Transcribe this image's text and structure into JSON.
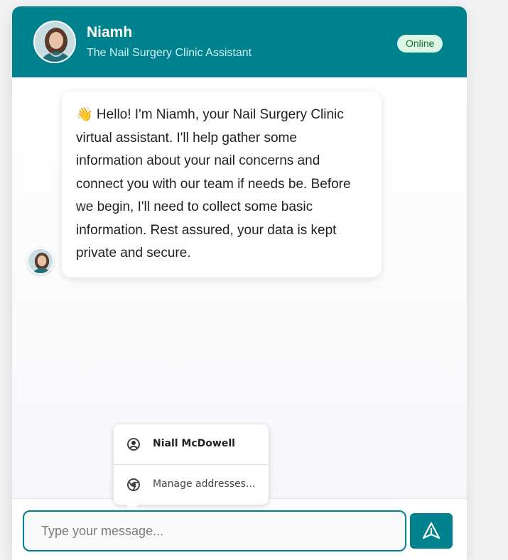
{
  "header": {
    "name": "Niamh",
    "subtitle": "The Nail Surgery Clinic Assistant",
    "status": "Online"
  },
  "messages": [
    {
      "sender": "assistant",
      "text": "👋 Hello! I'm Niamh, your Nail Surgery Clinic virtual assistant. I'll help gather some information about your nail concerns and connect you with our team if needs be. Before we begin, I'll need to collect some basic information. Rest assured, your data is kept private and secure."
    }
  ],
  "autofill": {
    "items": [
      {
        "label": "Niall McDowell",
        "icon": "account-circle-icon"
      },
      {
        "label": "Manage addresses...",
        "icon": "chrome-icon"
      }
    ]
  },
  "composer": {
    "placeholder": "Type your message...",
    "value": "",
    "send_icon": "send-icon"
  },
  "colors": {
    "accent": "#00828e",
    "status_bg": "#dcf7e4",
    "status_text": "#1e6b3a"
  }
}
